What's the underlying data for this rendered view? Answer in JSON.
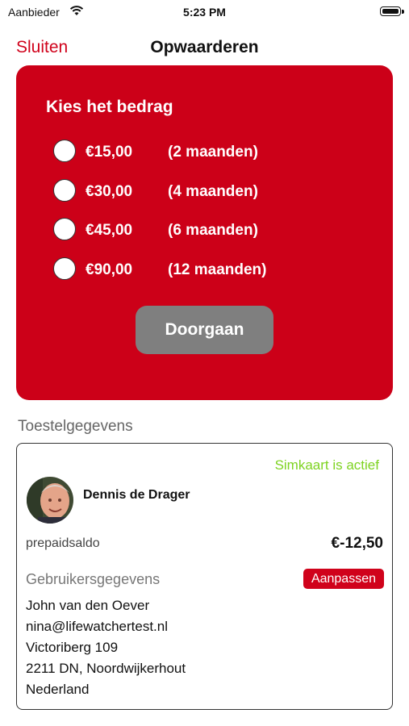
{
  "status_bar": {
    "carrier": "Aanbieder",
    "time": "5:23 PM"
  },
  "nav": {
    "close_label": "Sluiten",
    "title": "Opwaarderen"
  },
  "topup": {
    "heading": "Kies het bedrag",
    "options": [
      {
        "amount": "€15,00",
        "duration": "(2 maanden)",
        "selected": false
      },
      {
        "amount": "€30,00",
        "duration": "(4 maanden)",
        "selected": false
      },
      {
        "amount": "€45,00",
        "duration": "(6 maanden)",
        "selected": false
      },
      {
        "amount": "€90,00",
        "duration": "(12 maanden)",
        "selected": false
      }
    ],
    "continue_label": "Doorgaan",
    "accent_color": "#cc0018"
  },
  "device": {
    "section_title": "Toestelgegevens",
    "sim_status": "Simkaart is actief",
    "owner_name": "Dennis de Drager",
    "balance_label": "prepaidsaldo",
    "balance_value": "€-12,50",
    "user_section_label": "Gebruikersgegevens",
    "edit_label": "Aanpassen",
    "user_lines": [
      "John van den Oever",
      "nina@lifewatchertest.nl",
      "Victoriberg 109",
      "2211 DN, Noordwijkerhout",
      "Nederland"
    ]
  }
}
